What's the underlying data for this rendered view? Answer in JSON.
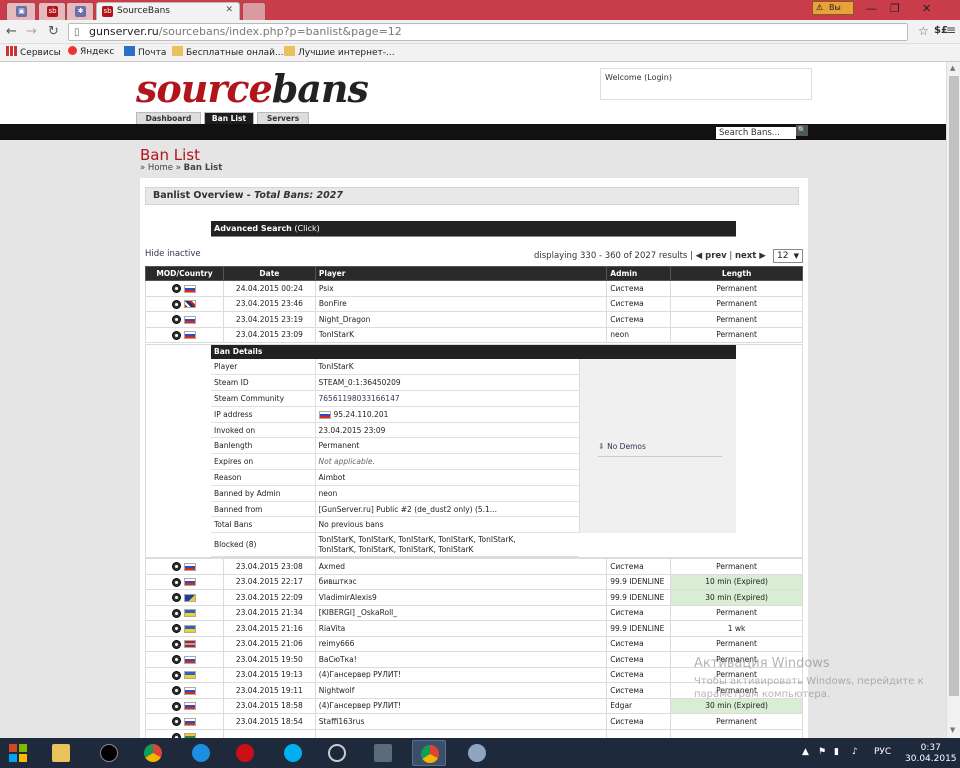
{
  "browser": {
    "tabs": [
      {
        "label": ""
      },
      {
        "label": ""
      },
      {
        "label": ""
      },
      {
        "label": "SourceBans"
      }
    ],
    "warning_label": "Вы",
    "url_host": "gunserver.ru",
    "url_path": "/sourcebans/index.php?p=banlist&page=12",
    "ext_label": "$£",
    "bookmarks": [
      "Сервисы",
      "Яндекс",
      "Почта",
      "Бесплатные онлай...",
      "Лучшие интернет-..."
    ]
  },
  "header": {
    "logo_part1": "source",
    "logo_part2": "bans",
    "welcome_text": "Welcome (Login)",
    "tabs": [
      "Dashboard",
      "Ban List",
      "Servers"
    ],
    "search_placeholder": "Search Bans..."
  },
  "page": {
    "title": "Ban List",
    "breadcrumb_home": "» Home »",
    "breadcrumb_current": "Ban List",
    "overview_label": "Banlist Overview - ",
    "overview_total": "Total Bans: 2027",
    "advanced_search": "Advanced Search",
    "advanced_search_hint": "(Click)",
    "hide_inactive": "Hide inactive",
    "displaying": "displaying 330 - 360 of 2027 results |",
    "prev": "◀ prev",
    "separator": "|",
    "next": "next ▶",
    "page_select": "12",
    "columns": [
      "MOD/Country",
      "Date",
      "Player",
      "Admin",
      "Length"
    ]
  },
  "bans_top": [
    {
      "flag": "ru",
      "date": "24.04.2015 00:24",
      "player": "Psix",
      "admin": "Система",
      "length": "Permanent",
      "expired": false
    },
    {
      "flag": "gb",
      "date": "23.04.2015 23:46",
      "player": "BonFire",
      "admin": "Система",
      "length": "Permanent",
      "expired": false
    },
    {
      "flag": "ru",
      "date": "23.04.2015 23:19",
      "player": "Night_Dragon",
      "admin": "Система",
      "length": "Permanent",
      "expired": false
    },
    {
      "flag": "ru",
      "date": "23.04.2015 23:09",
      "player": "TonIStarK",
      "admin": "neon",
      "length": "Permanent",
      "expired": false
    }
  ],
  "details": {
    "title": "Ban Details",
    "rows": [
      {
        "k": "Player",
        "v": "TonIStarK"
      },
      {
        "k": "Steam ID",
        "v": "STEAM_0:1:36450209"
      },
      {
        "k": "Steam Community",
        "v": "76561198033166147"
      },
      {
        "k": "IP address",
        "v": "95.24.110.201"
      },
      {
        "k": "Invoked on",
        "v": "23.04.2015 23:09"
      },
      {
        "k": "Banlength",
        "v": "Permanent"
      },
      {
        "k": "Expires on",
        "v": "Not applicable."
      },
      {
        "k": "Reason",
        "v": "Aimbot"
      },
      {
        "k": "Banned by Admin",
        "v": "neon"
      },
      {
        "k": "Banned from",
        "v": "[GunServer.ru] Public #2 (de_dust2 only) (5.1..."
      },
      {
        "k": "Total Bans",
        "v": "No previous bans"
      },
      {
        "k": "Blocked (8)",
        "v": "TonIStarK, TonIStarK, TonIStarK, TonIStarK, TonIStarK,\nTonIStarK, TonIStarK, TonIStarK, TonIStarK"
      }
    ],
    "no_demos": "No Demos"
  },
  "bans_bottom": [
    {
      "flag": "ru",
      "date": "23.04.2015 23:08",
      "player": "Axmed",
      "admin": "Система",
      "length": "Permanent",
      "expired": false
    },
    {
      "flag": "ru",
      "date": "23.04.2015 22:17",
      "player": "бившткэс",
      "admin": "99.9 IDENLINE",
      "length": "10 min (Expired)",
      "expired": true
    },
    {
      "flag": "ba",
      "date": "23.04.2015 22:09",
      "player": "VladimirAlexis9",
      "admin": "99.9 IDENLINE",
      "length": "30 min (Expired)",
      "expired": true
    },
    {
      "flag": "ua",
      "date": "23.04.2015 21:34",
      "player": "[KIBERGI] _OskaRoll_",
      "admin": "Система",
      "length": "Permanent",
      "expired": false
    },
    {
      "flag": "ua",
      "date": "23.04.2015 21:16",
      "player": "RiaVita",
      "admin": "99.9 IDENLINE",
      "length": "1 wk",
      "expired": false
    },
    {
      "flag": "lv",
      "date": "23.04.2015 21:06",
      "player": "reimy666",
      "admin": "Система",
      "length": "Permanent",
      "expired": false
    },
    {
      "flag": "ru",
      "date": "23.04.2015 19:50",
      "player": "ВаСюТка!",
      "admin": "Система",
      "length": "Permanent",
      "expired": false
    },
    {
      "flag": "ua",
      "date": "23.04.2015 19:13",
      "player": "(4)Гансервер РУЛИТ!",
      "admin": "Система",
      "length": "Permanent",
      "expired": false
    },
    {
      "flag": "ru",
      "date": "23.04.2015 19:11",
      "player": "Nightwolf",
      "admin": "Система",
      "length": "Permanent",
      "expired": false
    },
    {
      "flag": "ru",
      "date": "23.04.2015 18:58",
      "player": "(4)Гансервер РУЛИТ!",
      "admin": "Edgar",
      "length": "30 min (Expired)",
      "expired": true
    },
    {
      "flag": "ru",
      "date": "23.04.2015 18:54",
      "player": "Staffi163rus",
      "admin": "Система",
      "length": "Permanent",
      "expired": false
    },
    {
      "flag": "lt",
      "date": "",
      "player": "",
      "admin": "",
      "length": "",
      "expired": false
    }
  ],
  "watermark": {
    "title": "Активация Windows",
    "line1": "Чтобы активировать Windows, перейдите к",
    "line2": "параметрам компьютера."
  },
  "taskbar": {
    "lang": "РУС",
    "time": "0:37",
    "date": "30.04.2015"
  }
}
